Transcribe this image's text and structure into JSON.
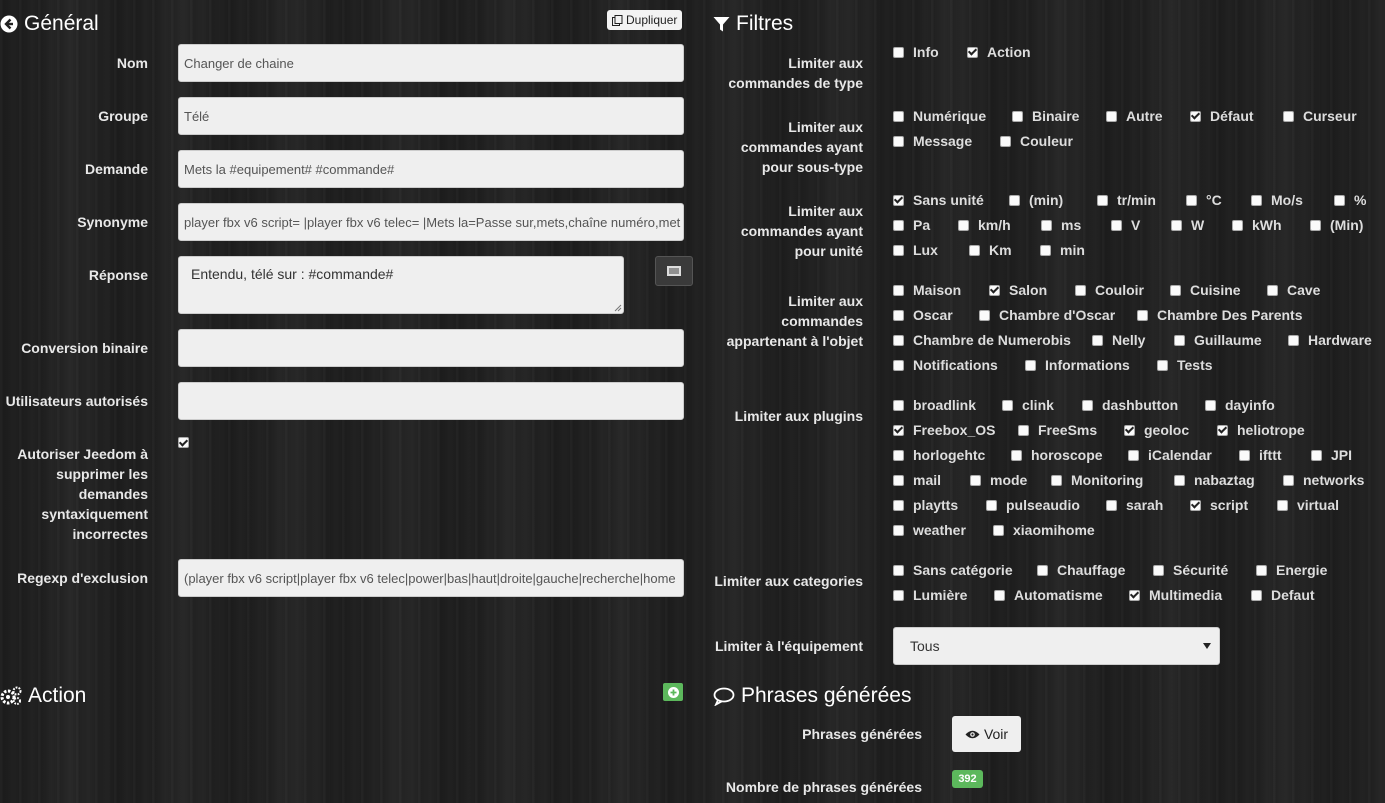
{
  "general": {
    "title": "Général",
    "duplicate_label": "Dupliquer",
    "fields": {
      "nom": {
        "label": "Nom",
        "value": "Changer de chaine"
      },
      "groupe": {
        "label": "Groupe",
        "value": "Télé"
      },
      "demande": {
        "label": "Demande",
        "value": "Mets la #equipement# #commande#"
      },
      "synonyme": {
        "label": "Synonyme",
        "value": "player fbx v6 script= |player fbx v6 telec= |Mets la=Passe sur,mets,chaîne numéro,met"
      },
      "reponse": {
        "label": "Réponse",
        "value": "Entendu, télé sur : #commande#"
      },
      "conversion": {
        "label": "Conversion binaire",
        "value": ""
      },
      "utilisateurs": {
        "label": "Utilisateurs autorisés",
        "value": ""
      },
      "autoriser": {
        "label_lines": [
          "Autoriser Jeedom à",
          "supprimer les",
          "demandes",
          "syntaxiquement",
          "incorrectes"
        ],
        "checked": true
      },
      "regexp": {
        "label": "Regexp d'exclusion",
        "value": "(player fbx v6 script|player fbx v6 telec|power|bas|haut|droite|gauche|recherche|home"
      }
    }
  },
  "action": {
    "title": "Action"
  },
  "filtres": {
    "title": "Filtres",
    "type": {
      "label_lines": [
        "Limiter aux",
        "commandes de type"
      ],
      "items": [
        {
          "label": "Info",
          "checked": false
        },
        {
          "label": "Action",
          "checked": true
        }
      ]
    },
    "soustype": {
      "label_lines": [
        "Limiter aux",
        "commandes ayant",
        "pour sous-type"
      ],
      "items": [
        {
          "label": "Numérique",
          "checked": false
        },
        {
          "label": "Binaire",
          "checked": false
        },
        {
          "label": "Autre",
          "checked": false
        },
        {
          "label": "Défaut",
          "checked": true
        },
        {
          "label": "Curseur",
          "checked": false
        },
        {
          "label": "Message",
          "checked": false
        },
        {
          "label": "Couleur",
          "checked": false
        }
      ]
    },
    "unite": {
      "label_lines": [
        "Limiter aux",
        "commandes ayant",
        "pour unité"
      ],
      "items": [
        {
          "label": "Sans unité",
          "checked": true
        },
        {
          "label": "(min)",
          "checked": false
        },
        {
          "label": "tr/min",
          "checked": false
        },
        {
          "label": "°C",
          "checked": false
        },
        {
          "label": "Mo/s",
          "checked": false
        },
        {
          "label": "%",
          "checked": false
        },
        {
          "label": "Pa",
          "checked": false
        },
        {
          "label": "km/h",
          "checked": false
        },
        {
          "label": "ms",
          "checked": false
        },
        {
          "label": "V",
          "checked": false
        },
        {
          "label": "W",
          "checked": false
        },
        {
          "label": "kWh",
          "checked": false
        },
        {
          "label": "(Min)",
          "checked": false
        },
        {
          "label": "Lux",
          "checked": false
        },
        {
          "label": "Km",
          "checked": false
        },
        {
          "label": "min",
          "checked": false
        }
      ]
    },
    "objet": {
      "label_lines": [
        "Limiter aux",
        "commandes",
        "appartenant à l'objet"
      ],
      "items": [
        {
          "label": "Maison",
          "checked": false
        },
        {
          "label": "Salon",
          "checked": true
        },
        {
          "label": "Couloir",
          "checked": false
        },
        {
          "label": "Cuisine",
          "checked": false
        },
        {
          "label": "Cave",
          "checked": false
        },
        {
          "label": "Oscar",
          "checked": false
        },
        {
          "label": "Chambre d'Oscar",
          "checked": false
        },
        {
          "label": "Chambre Des Parents",
          "checked": false
        },
        {
          "label": "Chambre de Numerobis",
          "checked": false
        },
        {
          "label": "Nelly",
          "checked": false
        },
        {
          "label": "Guillaume",
          "checked": false
        },
        {
          "label": "Hardware",
          "checked": false
        },
        {
          "label": "Notifications",
          "checked": false
        },
        {
          "label": "Informations",
          "checked": false
        },
        {
          "label": "Tests",
          "checked": false
        }
      ]
    },
    "plugins": {
      "label": "Limiter aux plugins",
      "items": [
        {
          "label": "broadlink",
          "checked": false
        },
        {
          "label": "clink",
          "checked": false
        },
        {
          "label": "dashbutton",
          "checked": false
        },
        {
          "label": "dayinfo",
          "checked": false
        },
        {
          "label": "Freebox_OS",
          "checked": true
        },
        {
          "label": "FreeSms",
          "checked": false
        },
        {
          "label": "geoloc",
          "checked": true
        },
        {
          "label": "heliotrope",
          "checked": true
        },
        {
          "label": "horlogehtc",
          "checked": false
        },
        {
          "label": "horoscope",
          "checked": false
        },
        {
          "label": "iCalendar",
          "checked": false
        },
        {
          "label": "ifttt",
          "checked": false
        },
        {
          "label": "JPI",
          "checked": false
        },
        {
          "label": "mail",
          "checked": false
        },
        {
          "label": "mode",
          "checked": false
        },
        {
          "label": "Monitoring",
          "checked": false
        },
        {
          "label": "nabaztag",
          "checked": false
        },
        {
          "label": "networks",
          "checked": false
        },
        {
          "label": "playtts",
          "checked": false
        },
        {
          "label": "pulseaudio",
          "checked": false
        },
        {
          "label": "sarah",
          "checked": false
        },
        {
          "label": "script",
          "checked": true
        },
        {
          "label": "virtual",
          "checked": false
        },
        {
          "label": "weather",
          "checked": false
        },
        {
          "label": "xiaomihome",
          "checked": false
        }
      ]
    },
    "categories": {
      "label": "Limiter aux categories",
      "items": [
        {
          "label": "Sans catégorie",
          "checked": false
        },
        {
          "label": "Chauffage",
          "checked": false
        },
        {
          "label": "Sécurité",
          "checked": false
        },
        {
          "label": "Energie",
          "checked": false
        },
        {
          "label": "Lumière",
          "checked": false
        },
        {
          "label": "Automatisme",
          "checked": false
        },
        {
          "label": "Multimedia",
          "checked": true
        },
        {
          "label": "Defaut",
          "checked": false
        }
      ]
    },
    "equipement": {
      "label": "Limiter à l'équipement",
      "value": "Tous"
    }
  },
  "phrases": {
    "title": "Phrases générées",
    "row_label": "Phrases générées",
    "voir_label": "Voir",
    "count_label": "Nombre de phrases générées",
    "count": "392"
  }
}
